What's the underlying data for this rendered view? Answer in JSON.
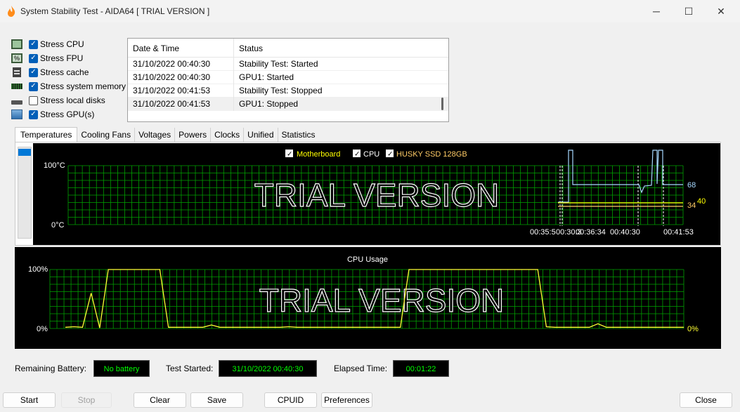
{
  "window": {
    "title": "System Stability Test - AIDA64  [ TRIAL VERSION ]",
    "minimize_glyph": "─",
    "maximize_glyph": "☐",
    "close_glyph": "✕"
  },
  "stress_options": [
    {
      "label": "Stress CPU",
      "checked": true,
      "icon": "cpu-chip-icon"
    },
    {
      "label": "Stress FPU",
      "checked": true,
      "icon": "fpu-icon"
    },
    {
      "label": "Stress cache",
      "checked": true,
      "icon": "cache-icon"
    },
    {
      "label": "Stress system memory",
      "checked": true,
      "icon": "memory-module-icon"
    },
    {
      "label": "Stress local disks",
      "checked": false,
      "icon": "disk-drive-icon"
    },
    {
      "label": "Stress GPU(s)",
      "checked": true,
      "icon": "gpu-icon"
    }
  ],
  "log": {
    "headers": [
      "Date & Time",
      "Status"
    ],
    "rows": [
      {
        "time": "31/10/2022 00:40:30",
        "status": "Stability Test: Started"
      },
      {
        "time": "31/10/2022 00:40:30",
        "status": "GPU1: Started"
      },
      {
        "time": "31/10/2022 00:41:53",
        "status": "Stability Test: Stopped"
      },
      {
        "time": "31/10/2022 00:41:53",
        "status": "GPU1: Stopped"
      }
    ]
  },
  "tabs": [
    "Temperatures",
    "Cooling Fans",
    "Voltages",
    "Powers",
    "Clocks",
    "Unified",
    "Statistics"
  ],
  "temp_graph": {
    "legend": [
      {
        "label": "Motherboard",
        "color": "#ffff00",
        "checked": true
      },
      {
        "label": "CPU",
        "color": "#ffffff",
        "checked": true
      },
      {
        "label": "HUSKY SSD 128GB",
        "color": "#ffcc66",
        "checked": true
      }
    ],
    "y_top": "100°C",
    "y_bottom": "0°C",
    "watermark": "TRIAL VERSION",
    "x_labels": [
      "00:35:5",
      "00:30:3",
      "00:36:34",
      "00:40:30",
      "00:41:53"
    ],
    "values": [
      {
        "text": "68",
        "color": "#a6d8ff"
      },
      {
        "text": "40",
        "color": "#ffff00"
      },
      {
        "text": "34",
        "color": "#ffcc66"
      }
    ],
    "grid_color": "#00a000"
  },
  "cpu_graph": {
    "title": "CPU Usage",
    "y_top": "100%",
    "y_bottom": "0%",
    "current": "0%",
    "watermark": "TRIAL VERSION",
    "line_color": "#ffff33",
    "samples": [
      2,
      3,
      2,
      60,
      1,
      100,
      100,
      100,
      100,
      100,
      100,
      100,
      2,
      2,
      2,
      2,
      2,
      6,
      2,
      2,
      2,
      2,
      2,
      2,
      2,
      2,
      3,
      2,
      2,
      2,
      2,
      2,
      2,
      2,
      2,
      2,
      2,
      2,
      2,
      2,
      100,
      100,
      100,
      100,
      100,
      100,
      100,
      100,
      100,
      100,
      100,
      100,
      100,
      100,
      100,
      100,
      3,
      2,
      2,
      2,
      2,
      2,
      8,
      2,
      2,
      2,
      2,
      2,
      2,
      2,
      2,
      2,
      2
    ]
  },
  "status": {
    "battery_label": "Remaining Battery:",
    "battery_value": "No battery",
    "started_label": "Test Started:",
    "started_value": "31/10/2022 00:40:30",
    "elapsed_label": "Elapsed Time:",
    "elapsed_value": "00:01:22"
  },
  "buttons": {
    "start": "Start",
    "stop": "Stop",
    "clear": "Clear",
    "save": "Save",
    "cpuid": "CPUID",
    "preferences": "Preferences",
    "close": "Close"
  }
}
